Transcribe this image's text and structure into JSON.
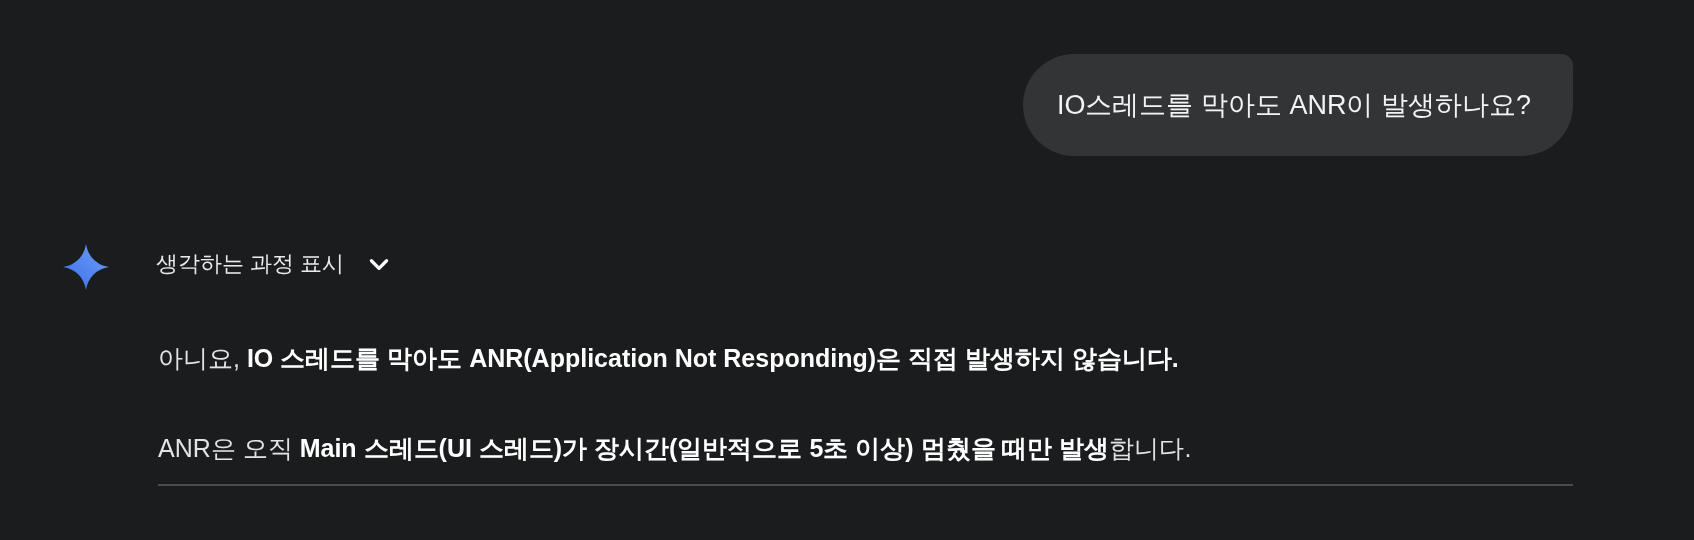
{
  "user_message": {
    "text": "IO스레드를 막아도 ANR이 발생하나요?"
  },
  "response": {
    "thinking_toggle": {
      "label": "생각하는 과정 표시",
      "expanded": false
    },
    "paragraphs": [
      "아니요, **IO 스레드를 막아도 ANR(Application Not Responding)은 직접 발생하지 않습니다.**",
      "ANR은 오직 **Main 스레드(UI 스레드)가 장시간(일반적으로 5초 이상) 멈췄을 때만 발생**합니다."
    ]
  }
}
